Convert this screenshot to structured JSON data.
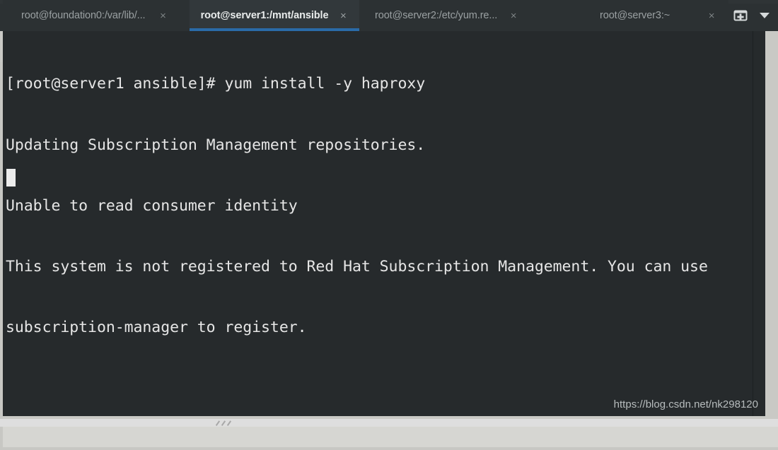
{
  "window": {
    "app": "terminal",
    "colors": {
      "tabbar_bg": "#2c3133",
      "active_tab_bg": "#32383b",
      "active_tab_accent": "#2a6ba8",
      "terminal_bg": "#262a2c",
      "terminal_fg": "#e6e6e6",
      "frame_bg": "#dedede",
      "watermark_fg": "#b7bcbd"
    }
  },
  "tabbar": {
    "tabs": [
      {
        "label": "root@foundation0:/var/lib/...",
        "close_label": "×",
        "active": false
      },
      {
        "label": "root@server1:/mnt/ansible",
        "close_label": "×",
        "active": true
      },
      {
        "label": "root@server2:/etc/yum.re...",
        "close_label": "×",
        "active": false
      },
      {
        "label": "root@server3:~",
        "close_label": "×",
        "active": false
      }
    ],
    "actions": {
      "new_tab_icon": "new-tab-icon",
      "new_tab_tooltip": "New Tab",
      "tab_list_icon": "chevron-down-icon",
      "tab_list_tooltip": "Tab list"
    }
  },
  "terminal": {
    "prompt": "[root@server1 ansible]#",
    "command": "yum install -y haproxy",
    "lines": [
      "[root@server1 ansible]# yum install -y haproxy",
      "Updating Subscription Management repositories.",
      "Unable to read consumer identity",
      "This system is not registered to Red Hat Subscription Management. You can use",
      "subscription-manager to register."
    ],
    "cursor_visible": true,
    "cursor_row": 5,
    "cursor_col": 0
  },
  "watermark": {
    "text": "https://blog.csdn.net/nk298120"
  },
  "statusbar": {
    "resize_grip_icon": "resize-grip-icon"
  }
}
